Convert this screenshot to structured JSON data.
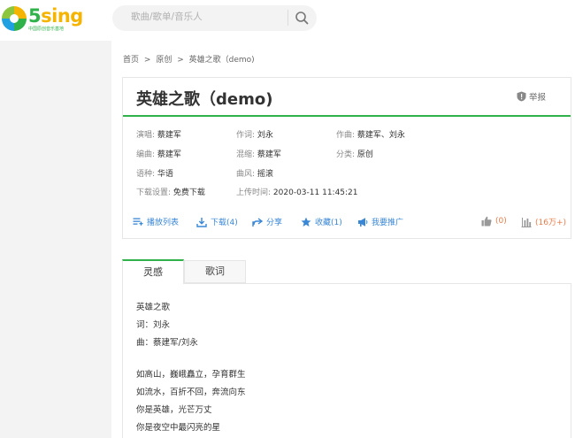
{
  "header": {
    "logo_text_five": "5",
    "logo_text_sing": "sing",
    "logo_sub": "中国原创音乐基地",
    "search_placeholder": "歌曲/歌单/音乐人"
  },
  "breadcrumb": [
    "首页",
    ">",
    "原创",
    ">",
    "英雄之歌（demo)"
  ],
  "song": {
    "title": "英雄之歌（demo)",
    "report_label": "举报"
  },
  "meta": [
    {
      "key": "演唱:",
      "value": "蔡建军"
    },
    {
      "key": "作词:",
      "value": "刘永"
    },
    {
      "key": "作曲:",
      "value": "蔡建军、刘永"
    },
    {
      "key": "编曲:",
      "value": "蔡建军"
    },
    {
      "key": "混缩:",
      "value": "蔡建军"
    },
    {
      "key": "分类:",
      "value": "原创"
    },
    {
      "key": "语种:",
      "value": "华语"
    },
    {
      "key": "曲风:",
      "value": "摇滚"
    },
    {
      "key": "下载设置:",
      "value": "免费下载"
    },
    {
      "key": "上传时间:",
      "value": "2020-03-11 11:45:21"
    }
  ],
  "actions": {
    "playlist": "播放列表",
    "download": "下载(4)",
    "share": "分享",
    "favorite": "收藏(1)",
    "promote": "我要推广",
    "likes": "(0)",
    "plays": "(16万+)"
  },
  "tabs": [
    "灵感",
    "歌词"
  ],
  "lyrics": [
    "英雄之歌",
    "词：刘永",
    "曲：蔡建军/刘永",
    "",
    "如高山，巍峨矗立，孕育群生",
    "如流水，百折不回，奔流向东",
    "你是英雄，光芒万丈",
    "你是夜空中最闪亮的星"
  ],
  "colors": {
    "brand_green": "#2fb24a",
    "brand_yellow": "#f4b400",
    "link_blue": "#3a87d6",
    "count_orange": "#e57c4a"
  }
}
